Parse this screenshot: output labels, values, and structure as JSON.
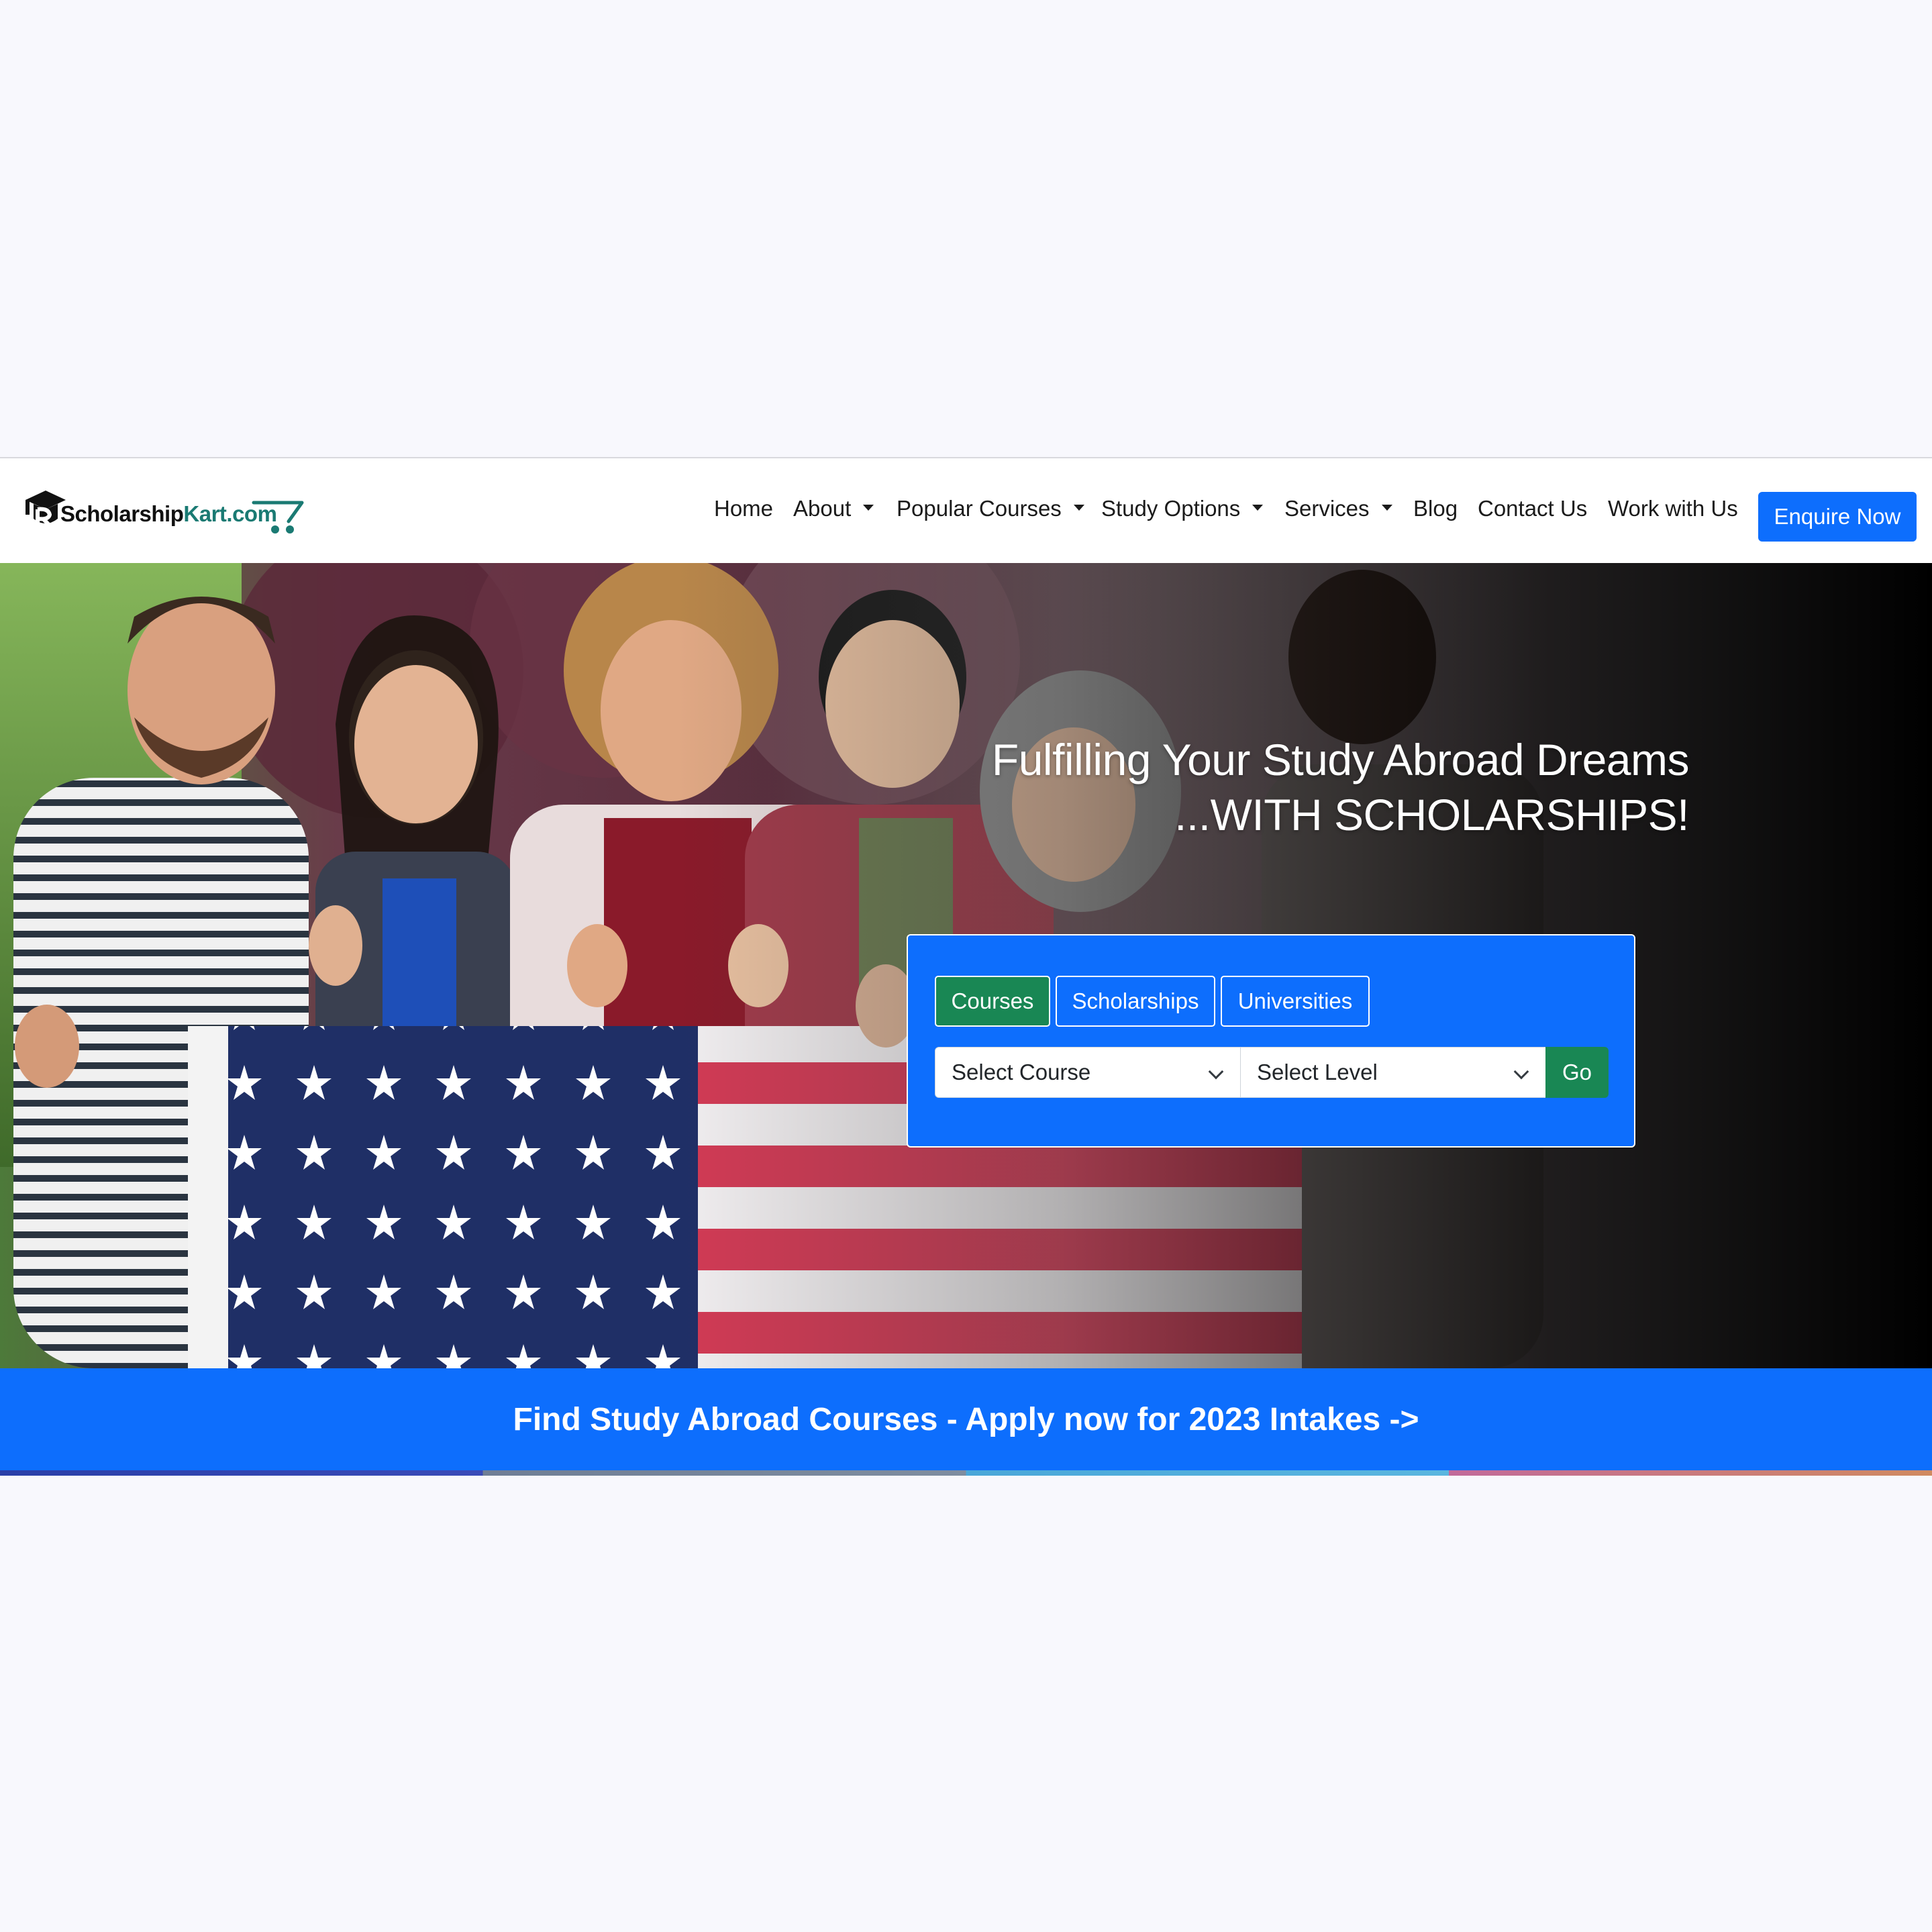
{
  "brand": {
    "name_part1": "Scholarship",
    "name_part2": "Kart.com",
    "accent_color": "#1a7a73"
  },
  "nav": {
    "items": [
      {
        "label": "Home",
        "dropdown": false
      },
      {
        "label": "About",
        "dropdown": true
      },
      {
        "label": "Popular Courses",
        "dropdown": true
      },
      {
        "label": "Study Options",
        "dropdown": true
      },
      {
        "label": "Services",
        "dropdown": true
      },
      {
        "label": "Blog",
        "dropdown": false
      },
      {
        "label": "Contact Us",
        "dropdown": false
      },
      {
        "label": "Work with Us",
        "dropdown": false
      }
    ],
    "cta_label": "Enquire Now"
  },
  "hero": {
    "title_line1": "Fulfilling Your Study Abroad Dreams",
    "title_line2": "...WITH SCHOLARSHIPS!"
  },
  "search": {
    "tabs": [
      {
        "label": "Courses",
        "active": true
      },
      {
        "label": "Scholarships",
        "active": false
      },
      {
        "label": "Universities",
        "active": false
      }
    ],
    "course_select_value": "Select Course",
    "level_select_value": "Select Level",
    "go_label": "Go"
  },
  "banner": {
    "text": "Find Study Abroad Courses - Apply now for 2023 Intakes ->"
  },
  "colors": {
    "primary": "#0d6efd",
    "success": "#198754",
    "page_bg": "#f8f8fd"
  }
}
